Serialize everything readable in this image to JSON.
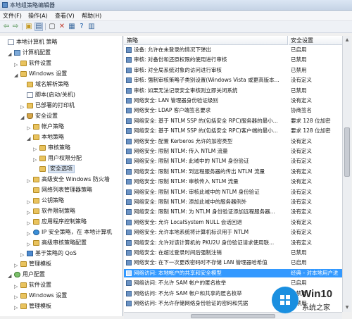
{
  "window": {
    "title": "本地组策略编辑器"
  },
  "menu": [
    "文件(F)",
    "操作(A)",
    "查看(V)",
    "帮助(H)"
  ],
  "tree": [
    {
      "label": "本地计算机 策略",
      "indent": 0,
      "icon": "doc",
      "exp": ""
    },
    {
      "label": "计算机配置",
      "indent": 1,
      "icon": "computer",
      "exp": "▲"
    },
    {
      "label": "软件设置",
      "indent": 2,
      "icon": "folder",
      "exp": "▷"
    },
    {
      "label": "Windows 设置",
      "indent": 2,
      "icon": "folder",
      "exp": "▲"
    },
    {
      "label": "域名解析策略",
      "indent": 3,
      "icon": "folder",
      "exp": ""
    },
    {
      "label": "脚本(启动/关机)",
      "indent": 3,
      "icon": "doc",
      "exp": ""
    },
    {
      "label": "已部署的打印机",
      "indent": 3,
      "icon": "folder",
      "exp": "▷"
    },
    {
      "label": "安全设置",
      "indent": 3,
      "icon": "shield",
      "exp": "▲"
    },
    {
      "label": "帐户策略",
      "indent": 4,
      "icon": "folder",
      "exp": "▷"
    },
    {
      "label": "本地策略",
      "indent": 4,
      "icon": "folder",
      "exp": "▲"
    },
    {
      "label": "审核策略",
      "indent": 5,
      "icon": "folder",
      "exp": "▷"
    },
    {
      "label": "用户权限分配",
      "indent": 5,
      "icon": "folder",
      "exp": "▷"
    },
    {
      "label": "安全选项",
      "indent": 5,
      "icon": "folder",
      "exp": "",
      "selected": true
    },
    {
      "label": "高级安全 Windows 防火墙",
      "indent": 4,
      "icon": "folder",
      "exp": "▷"
    },
    {
      "label": "网络列表管理器策略",
      "indent": 4,
      "icon": "folder",
      "exp": ""
    },
    {
      "label": "公钥策略",
      "indent": 4,
      "icon": "folder",
      "exp": "▷"
    },
    {
      "label": "软件限制策略",
      "indent": 4,
      "icon": "folder",
      "exp": "▷"
    },
    {
      "label": "应用程序控制策略",
      "indent": 4,
      "icon": "folder",
      "exp": "▷"
    },
    {
      "label": "IP 安全策略，在 本地计算机",
      "indent": 4,
      "icon": "globe",
      "exp": "▷"
    },
    {
      "label": "高级审核策略配置",
      "indent": 4,
      "icon": "folder",
      "exp": "▷"
    },
    {
      "label": "基于策略的 QoS",
      "indent": 3,
      "icon": "chart",
      "exp": "▷"
    },
    {
      "label": "管理模板",
      "indent": 2,
      "icon": "folder",
      "exp": "▷"
    },
    {
      "label": "用户配置",
      "indent": 1,
      "icon": "user",
      "exp": "▲"
    },
    {
      "label": "软件设置",
      "indent": 2,
      "icon": "folder",
      "exp": "▷"
    },
    {
      "label": "Windows 设置",
      "indent": 2,
      "icon": "folder",
      "exp": "▷"
    },
    {
      "label": "管理模板",
      "indent": 2,
      "icon": "folder",
      "exp": "▷"
    }
  ],
  "list": {
    "col_policy": "策略",
    "col_setting": "安全设置",
    "rows": [
      {
        "policy": "设备: 允许在未登录的情况下弹出",
        "setting": "已启用"
      },
      {
        "policy": "审核: 对备份和还原权限的使用进行审核",
        "setting": "已禁用"
      },
      {
        "policy": "审核: 对全局系统对象的访问进行审核",
        "setting": "已禁用"
      },
      {
        "policy": "审核: 强制审核策略子类别设置(Windows Vista 或更高版本...",
        "setting": "没有定义"
      },
      {
        "policy": "审核: 如果无法记录安全审核则立即关闭系统",
        "setting": "已禁用"
      },
      {
        "policy": "网络安全: LAN 管理器身份验证级别",
        "setting": "没有定义"
      },
      {
        "policy": "网络安全: LDAP 客户端签名要求",
        "setting": "协商签名"
      },
      {
        "policy": "网络安全: 基于 NTLM SSP 的(包括安全 RPC)服务器的最小...",
        "setting": "要求 128 位加密"
      },
      {
        "policy": "网络安全: 基于 NTLM SSP 的(包括安全 RPC)客户端的最小...",
        "setting": "要求 128 位加密"
      },
      {
        "policy": "网络安全: 配置 Kerberos 允许的加密类型",
        "setting": "没有定义"
      },
      {
        "policy": "网络安全: 限制 NTLM: 传入 NTLM 流量",
        "setting": "没有定义"
      },
      {
        "policy": "网络安全: 限制 NTLM: 此域中的 NTLM 身份验证",
        "setting": "没有定义"
      },
      {
        "policy": "网络安全: 限制 NTLM: 到远程服务器的传出 NTLM 流量",
        "setting": "没有定义"
      },
      {
        "policy": "网络安全: 限制 NTLM: 审核传入 NTLM 流量",
        "setting": "没有定义"
      },
      {
        "policy": "网络安全: 限制 NTLM: 审核此域中的 NTLM 身份验证",
        "setting": "没有定义"
      },
      {
        "policy": "网络安全: 限制 NTLM: 添加此域中的服务器例外",
        "setting": "没有定义"
      },
      {
        "policy": "网络安全: 限制 NTLM: 为 NTLM 身份验证添加远程服务器...",
        "setting": "没有定义"
      },
      {
        "policy": "网络安全: 允许 LocalSystem NULL 会话回退",
        "setting": "没有定义"
      },
      {
        "policy": "网络安全: 允许本地系统将计算机标识用于 NTLM",
        "setting": "没有定义"
      },
      {
        "policy": "网络安全: 允许对该计算机的 PKU2U 身份验证请求使用联...",
        "setting": "没有定义"
      },
      {
        "policy": "网络安全: 在超过登录时间后强制注销",
        "setting": "已禁用"
      },
      {
        "policy": "网络安全: 在下一次更改密码时不存储 LAN 管理器哈希值",
        "setting": "已启用"
      },
      {
        "policy": "网络访问: 本地帐户的共享和安全模型",
        "setting": "经典 - 对本地用户进",
        "selected": true
      },
      {
        "policy": "网络访问: 不允许 SAM 帐户的匿名枚举",
        "setting": "已启用"
      },
      {
        "policy": "网络访问: 不允许 SAM 帐户和共享的匿名枚举",
        "setting": "已禁用"
      },
      {
        "policy": "网络访问: 不允许存储网络身份验证的密码和凭据",
        "setting": "已禁用"
      }
    ]
  },
  "watermark": {
    "title": "Win10",
    "subtitle": "系统之家",
    "color": "#1a8fe0"
  }
}
